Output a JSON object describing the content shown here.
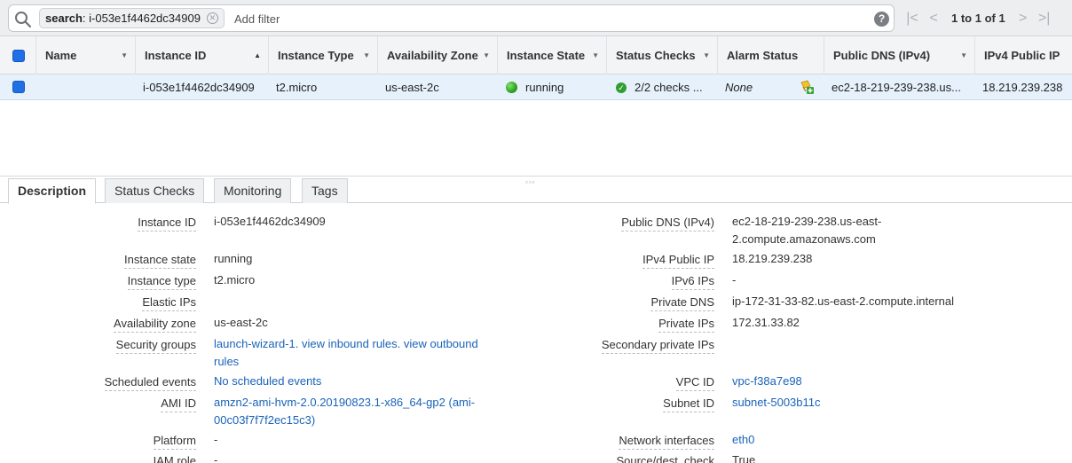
{
  "filter": {
    "token_key": "search",
    "token_value": ": i-053e1f4462dc34909",
    "add_filter_placeholder": "Add filter",
    "help": "?"
  },
  "pagination": {
    "first": "|<",
    "prev": "<",
    "label": "1 to 1 of 1",
    "next": ">",
    "last": ">|"
  },
  "table": {
    "columns": [
      "Name",
      "Instance ID",
      "Instance Type",
      "Availability Zone",
      "Instance State",
      "Status Checks",
      "Alarm Status",
      "Public DNS (IPv4)",
      "IPv4 Public IP"
    ],
    "row": {
      "name": "",
      "instance_id": "i-053e1f4462dc34909",
      "instance_type": "t2.micro",
      "availability_zone": "us-east-2c",
      "instance_state": "running",
      "status_checks": "2/2 checks ...",
      "alarm_status": "None",
      "public_dns": "ec2-18-219-239-238.us...",
      "ipv4_public_ip": "18.219.239.238"
    },
    "state_color": "#2ea01f"
  },
  "tabs": [
    "Description",
    "Status Checks",
    "Monitoring",
    "Tags"
  ],
  "details_left": {
    "instance_id_label": "Instance ID",
    "instance_id": "i-053e1f4462dc34909",
    "instance_state_label": "Instance state",
    "instance_state": "running",
    "instance_type_label": "Instance type",
    "instance_type": "t2.micro",
    "elastic_ips_label": "Elastic IPs",
    "availability_zone_label": "Availability zone",
    "availability_zone": "us-east-2c",
    "security_groups_label": "Security groups",
    "security_groups_line1": "launch-wizard-1. view inbound rules. view outbound",
    "security_groups_line2": "rules",
    "scheduled_events_label": "Scheduled events",
    "scheduled_events": "No scheduled events",
    "ami_id_label": "AMI ID",
    "ami_id_line1": "amzn2-ami-hvm-2.0.20190823.1-x86_64-gp2 (ami-",
    "ami_id_line2": "00c03f7f7f2ec15c3)",
    "platform_label": "Platform",
    "platform": "-",
    "iam_role_label": "IAM role",
    "iam_role": "-"
  },
  "details_right": {
    "public_dns_label": "Public DNS (IPv4)",
    "public_dns_line1": "ec2-18-219-239-238.us-east-",
    "public_dns_line2": "2.compute.amazonaws.com",
    "ipv4_public_ip_label": "IPv4 Public IP",
    "ipv4_public_ip": "18.219.239.238",
    "ipv6_ips_label": "IPv6 IPs",
    "ipv6_ips": "-",
    "private_dns_label": "Private DNS",
    "private_dns": "ip-172-31-33-82.us-east-2.compute.internal",
    "private_ips_label": "Private IPs",
    "private_ips": "172.31.33.82",
    "secondary_private_ips_label": "Secondary private IPs",
    "vpc_id_label": "VPC ID",
    "vpc_id": "vpc-f38a7e98",
    "subnet_id_label": "Subnet ID",
    "subnet_id": "subnet-5003b11c",
    "network_interfaces_label": "Network interfaces",
    "network_interfaces": "eth0",
    "source_dest_check_label": "Source/dest. check",
    "source_dest_check": "True"
  },
  "colors": {
    "link": "#1a63b8",
    "selected_row": "#e6f1fb",
    "checkbox": "#1f6fe5"
  }
}
